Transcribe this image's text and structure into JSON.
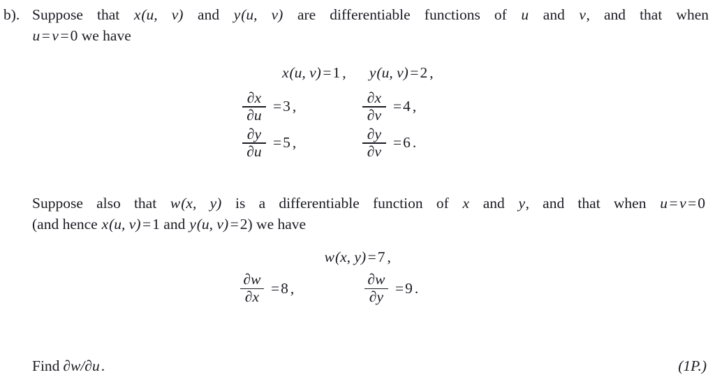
{
  "document": {
    "type": "math-exercise",
    "background_color": "#ffffff",
    "text_color": "#1a1a22"
  },
  "problem": {
    "label": "b).",
    "intro_line_1": "Suppose that x(u, v) and y(u, v) are differentiable functions of u and v, and that when",
    "intro_line_2": "u = v = 0 we have",
    "intro_line_1_parts": {
      "t1": "Suppose that ",
      "m1": "x",
      "m1_args": "(u, v)",
      "t2": " and ",
      "m2": "y",
      "m2_args": "(u, v)",
      "t3": " are differentiable functions of ",
      "m3": "u",
      "t4": " and ",
      "m4": "v",
      "t5": ", and that when"
    },
    "intro_line_2_parts": {
      "m1": "u",
      "op1": "=",
      "m2": "v",
      "op2": "=",
      "n1": "0",
      "t1": " we have"
    }
  },
  "equations_block_1": {
    "row_values": {
      "x_value_label": "x(u, v) = 1 ,",
      "y_value_label": "y(u, v) = 2 ,"
    },
    "values_row": {
      "left": {
        "func": "x",
        "args": "(u, v)",
        "eq": "=",
        "value": "1",
        "punct": ","
      },
      "right": {
        "func": "y",
        "args": "(u, v)",
        "eq": "=",
        "value": "2",
        "punct": ","
      }
    },
    "partials": [
      {
        "numerator": "∂x",
        "denominator": "∂u",
        "eq": "=",
        "value": "3",
        "punct": ","
      },
      {
        "numerator": "∂x",
        "denominator": "∂v",
        "eq": "=",
        "value": "4",
        "punct": ","
      },
      {
        "numerator": "∂y",
        "denominator": "∂u",
        "eq": "=",
        "value": "5",
        "punct": ","
      },
      {
        "numerator": "∂y",
        "denominator": "∂v",
        "eq": "=",
        "value": "6",
        "punct": "."
      }
    ]
  },
  "middle_paragraph": {
    "line_1": "Suppose also that w(x, y) is a differentiable function of x and y, and that when u = v = 0",
    "line_2": "(and hence x(u, v) = 1 and y(u, v) = 2) we have",
    "line_1_parts": {
      "t1": "Suppose also that ",
      "m1": "w",
      "m1_args": "(x, y)",
      "t2": " is a differentiable function of ",
      "m2": "x",
      "t3": " and ",
      "m3": "y",
      "t4": ", and that when ",
      "m4": "u",
      "op1": "=",
      "m5": "v",
      "op2": "=",
      "n1": "0"
    },
    "line_2_parts": {
      "t1": "(and hence ",
      "m1": "x",
      "m1_args": "(u, v)",
      "op1": "=",
      "n1": "1",
      "t2": " and ",
      "m2": "y",
      "m2_args": "(u, v)",
      "op2": "=",
      "n2": "2",
      "t3": ") we have"
    }
  },
  "equations_block_2": {
    "values_row": {
      "func": "w",
      "args": "(x, y)",
      "eq": "=",
      "value": "7",
      "punct": ","
    },
    "partials": [
      {
        "numerator": "∂w",
        "denominator": "∂x",
        "eq": "=",
        "value": "8",
        "punct": ","
      },
      {
        "numerator": "∂w",
        "denominator": "∂y",
        "eq": "=",
        "value": "9",
        "punct": "."
      }
    ]
  },
  "footer": {
    "find_prefix": "Find",
    "find_expression": "∂w/∂u",
    "find_punct": ".",
    "points": "(1P.)"
  }
}
